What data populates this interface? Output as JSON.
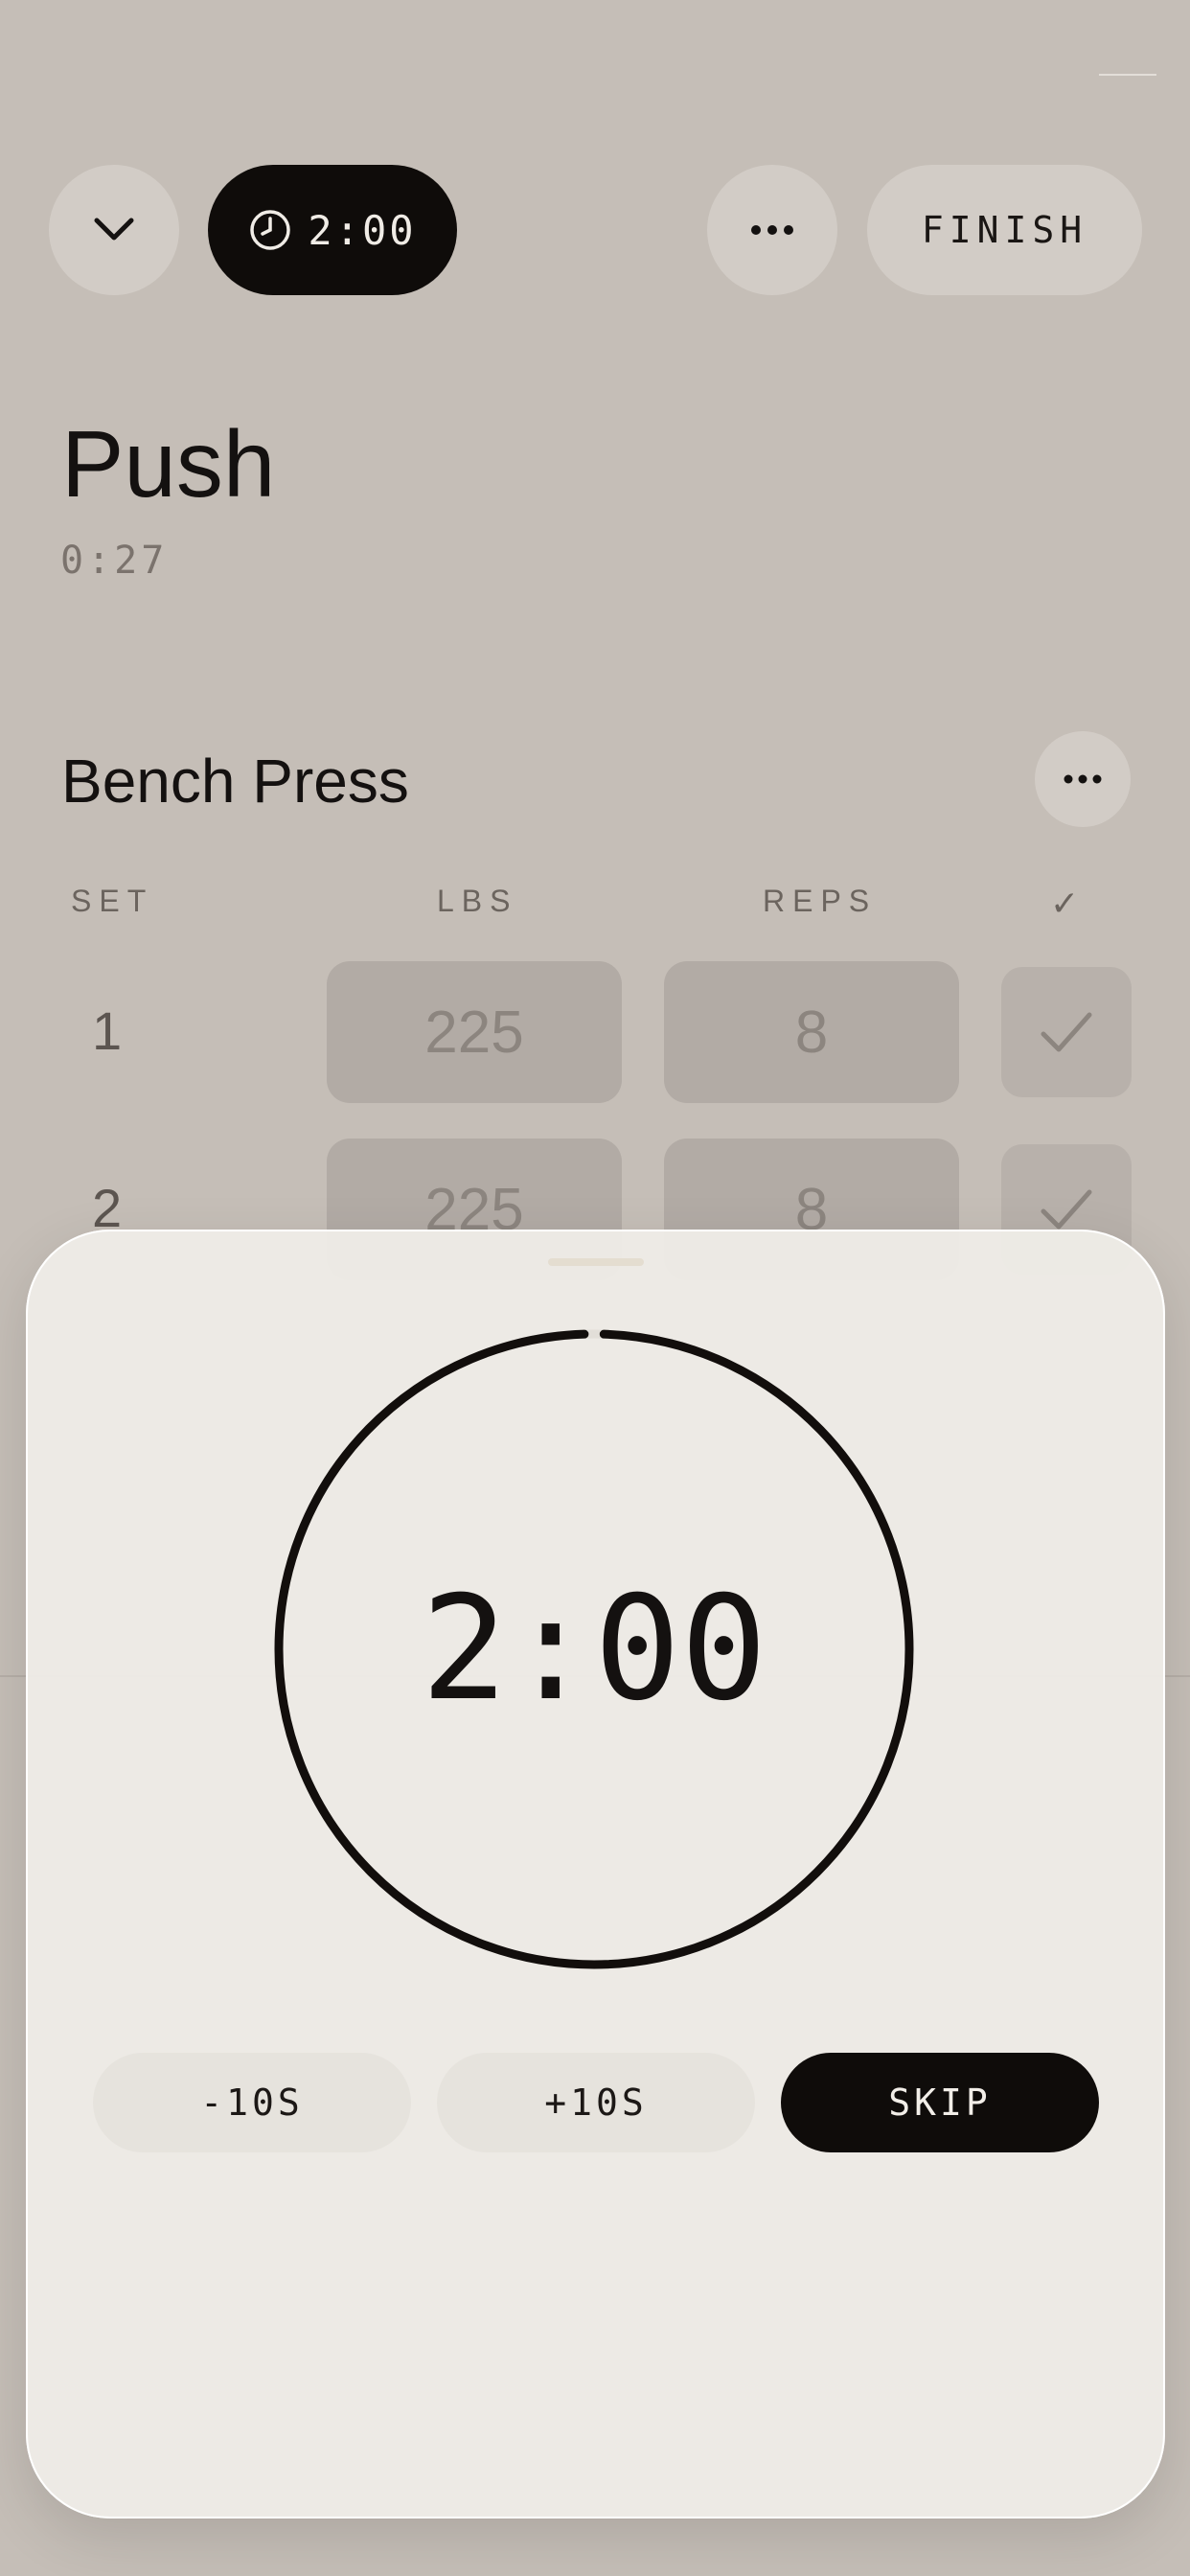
{
  "header": {
    "rest_timer": "2:00",
    "finish_label": "FINISH"
  },
  "workout": {
    "title": "Push",
    "elapsed": "0:27"
  },
  "exercise": {
    "name": "Bench Press",
    "columns": {
      "set": "SET",
      "lbs": "LBS",
      "reps": "REPS",
      "done": "✓"
    },
    "sets": [
      {
        "set": "1",
        "lbs": "225",
        "reps": "8",
        "done": true
      },
      {
        "set": "2",
        "lbs": "225",
        "reps": "8",
        "done": true
      }
    ]
  },
  "rest_sheet": {
    "countdown": "2:00",
    "progress": 0.99,
    "minus_label": "-10S",
    "plus_label": "+10S",
    "skip_label": "SKIP"
  },
  "colors": {
    "background": "#c5beb7",
    "accent_dark": "#0f0c0a",
    "sheet": "#efede8"
  },
  "icons": {
    "collapse": "chevron-down-icon",
    "timer": "clock-icon",
    "menu": "more-horizontal-icon",
    "done": "checkmark-icon"
  }
}
